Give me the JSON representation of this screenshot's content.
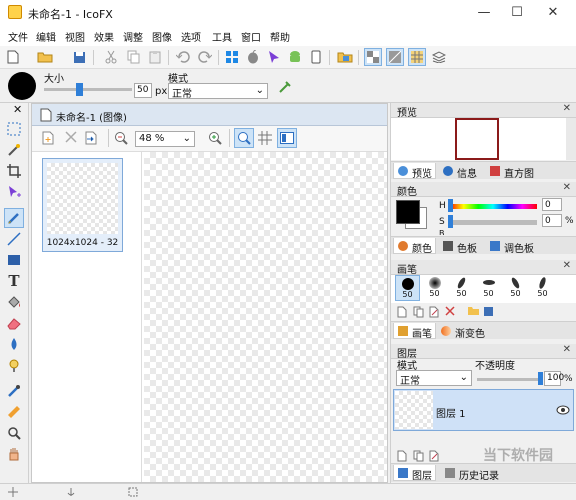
{
  "window": {
    "title": "未命名-1 - IcoFX",
    "minimize": "—",
    "maximize": "☐",
    "close": "✕"
  },
  "menu": [
    "文件",
    "编辑",
    "视图",
    "效果",
    "调整",
    "图像",
    "选项",
    "工具",
    "窗口",
    "帮助"
  ],
  "options": {
    "size_label": "大小",
    "size_value": "50",
    "size_unit": "px",
    "mode_label": "模式",
    "mode_value": "正常",
    "size_fraction": 0.4
  },
  "document": {
    "tab_title": "未命名-1 (图像)",
    "zoom": "48 %",
    "thumb_label": "1024x1024 - 32"
  },
  "preview": {
    "title": "预览",
    "close": "✕",
    "tabs": [
      "预览",
      "信息",
      "直方图"
    ]
  },
  "color": {
    "title": "颜色",
    "close": "✕",
    "h_label": "H",
    "s_label": "S",
    "b_label": "B",
    "h_value": "0",
    "s_value": "0",
    "h_unit": "",
    "s_unit": "%",
    "tabs": [
      "颜色",
      "色板",
      "调色板"
    ],
    "primary": "#000000"
  },
  "brush": {
    "title": "画笔",
    "close": "✕",
    "sizes": [
      "50",
      "50",
      "50",
      "50",
      "50",
      "50"
    ],
    "tabs": [
      "画笔",
      "渐变色"
    ]
  },
  "layers": {
    "title": "图层",
    "close": "✕",
    "mode_label": "模式",
    "mode_value": "正常",
    "opacity_label": "不透明度",
    "opacity_value": "100",
    "opacity_unit": "%",
    "layer_name": "图层 1",
    "tabs": [
      "图层",
      "历史记录"
    ]
  },
  "watermark": "当下软件园"
}
